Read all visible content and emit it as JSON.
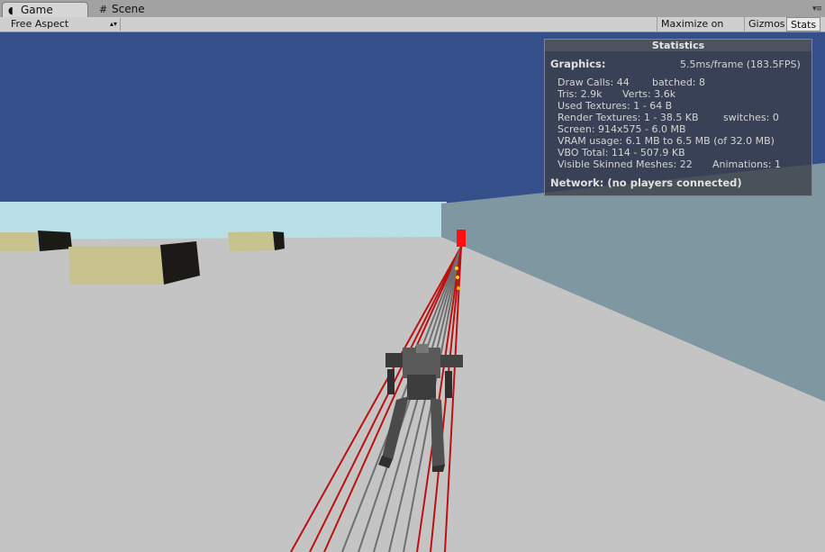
{
  "tabs": {
    "game_label": "Game",
    "scene_label": "Scene",
    "game_icon": "pacman-icon",
    "scene_icon": "grid-icon",
    "menu_glyph": "▾≡"
  },
  "toolbar": {
    "aspect_value": "Free Aspect",
    "aspect_arrow": "▴▾",
    "maximize_label": "Maximize on Play",
    "gizmos_label": "Gizmos",
    "stats_label": "Stats"
  },
  "stats": {
    "title": "Statistics",
    "graphics_label": "Graphics:",
    "frame_time": "5.5ms/frame (183.5FPS)",
    "draw_calls": "Draw Calls: 44",
    "batched": "batched: 8",
    "tris": "Tris: 2.9k",
    "verts": "Verts: 3.6k",
    "used_textures": "Used Textures: 1 - 64 B",
    "render_textures": "Render Textures: 1 - 38.5 KB",
    "switches": "switches: 0",
    "screen": "Screen: 914x575 - 6.0 MB",
    "vram": "VRAM usage: 6.1 MB to 6.5 MB (of 32.0 MB)",
    "vbo": "VBO Total: 114 - 507.9 KB",
    "skinned_meshes": "Visible Skinned Meshes: 22",
    "animations": "Animations: 1",
    "network": "Network: (no players connected)"
  },
  "colors": {
    "sky": "#354f8a",
    "horizon": "#b8e0e6",
    "floor": "#c4c4c4",
    "wall": "#7e97a0",
    "box_top": "#c8c28e",
    "box_side": "#1c1a17",
    "ray_red": "#bb1111",
    "ray_gray": "#6f6f6f",
    "target": "#ff1010"
  }
}
